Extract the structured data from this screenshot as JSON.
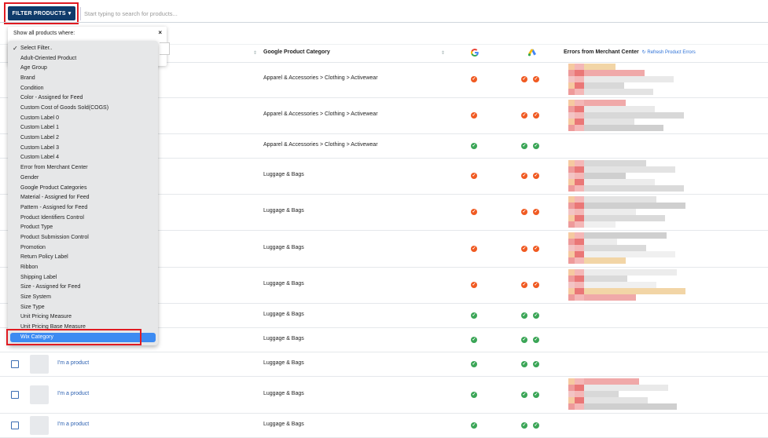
{
  "toolbar": {
    "filter_label": "FILTER PRODUCTS",
    "search_placeholder": "Start typing to search for products..."
  },
  "table": {
    "headers": {
      "google_category": "Google Product Category",
      "errors": "Errors from Merchant Center",
      "refresh": "Refresh Product Errors"
    },
    "rows": [
      {
        "category": "Apparel & Accessories > Clothing > Activewear",
        "google": "error",
        "ads": [
          "error",
          "error"
        ],
        "has_errors": true,
        "has_thumb": false
      },
      {
        "category": "Apparel & Accessories > Clothing > Activewear",
        "google": "error",
        "ads": [
          "error",
          "error"
        ],
        "has_errors": true,
        "has_thumb": false
      },
      {
        "category": "Apparel & Accessories > Clothing > Activewear",
        "google": "ok",
        "ads": [
          "ok",
          "ok"
        ],
        "has_errors": false,
        "has_thumb": false
      },
      {
        "category": "Luggage & Bags",
        "google": "error",
        "ads": [
          "error",
          "error"
        ],
        "has_errors": true,
        "has_thumb": false
      },
      {
        "category": "Luggage & Bags",
        "google": "error",
        "ads": [
          "error",
          "error"
        ],
        "has_errors": true,
        "has_thumb": false
      },
      {
        "category": "Luggage & Bags",
        "google": "error",
        "ads": [
          "error",
          "error"
        ],
        "has_errors": true,
        "has_thumb": false
      },
      {
        "category": "Luggage & Bags",
        "google": "error",
        "ads": [
          "error",
          "error"
        ],
        "has_errors": true,
        "has_thumb": false
      },
      {
        "category": "Luggage & Bags",
        "google": "ok",
        "ads": [
          "ok",
          "ok"
        ],
        "has_errors": false,
        "has_thumb": false
      },
      {
        "category": "Luggage & Bags",
        "google": "ok",
        "ads": [
          "ok",
          "ok"
        ],
        "has_errors": false,
        "has_thumb": false
      },
      {
        "category": "Luggage & Bags",
        "google": "ok",
        "ads": [
          "ok",
          "ok"
        ],
        "has_errors": false,
        "has_thumb": true,
        "name": "I'm a product"
      },
      {
        "category": "Luggage & Bags",
        "google": "ok",
        "ads": [
          "ok",
          "ok"
        ],
        "has_errors": true,
        "has_thumb": true,
        "name": "I'm a product"
      },
      {
        "category": "Luggage & Bags",
        "google": "ok",
        "ads": [
          "ok",
          "ok"
        ],
        "has_errors": false,
        "has_thumb": true,
        "name": "I'm a product"
      }
    ]
  },
  "filter_panel": {
    "title": "Show all products where:",
    "close": "×",
    "options": [
      "Select Filter..",
      "Adult-Oriented Product",
      "Age Group",
      "Brand",
      "Condition",
      "Color - Assigned for Feed",
      "Custom Cost of Goods Sold(COGS)",
      "Custom Label 0",
      "Custom Label 1",
      "Custom Label 2",
      "Custom Label 3",
      "Custom Label 4",
      "Error from Merchant Center",
      "Gender",
      "Google Product Categories",
      "Material - Assigned for Feed",
      "Pattern - Assigned for Feed",
      "Product Identifiers Control",
      "Product Type",
      "Product Submission Control",
      "Promotion",
      "Return Policy Label",
      "Ribbon",
      "Shipping Label",
      "Size - Assigned for Feed",
      "Size System",
      "Size Type",
      "Unit Pricing Measure",
      "Unit Pricing Base Measure",
      "Wix Category"
    ],
    "checked_index": 0,
    "selected_index": 29
  },
  "colors": {
    "primary": "#0f3b6b",
    "highlight": "#e01b22",
    "ok": "#3aa556",
    "error": "#f05a22",
    "selected": "#3d8bf2"
  }
}
